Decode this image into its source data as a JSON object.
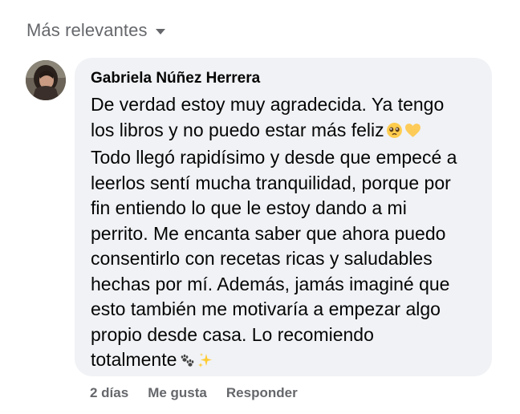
{
  "sort": {
    "label": "Más relevantes"
  },
  "comment": {
    "author": "Gabriela Núñez Herrera",
    "text_lines": [
      "De verdad estoy muy agradecida. Ya tengo",
      "los libros y no puedo estar más feliz",
      "Todo llegó rapidísimo y desde que empecé a",
      "leerlos sentí mucha tranquilidad, porque por",
      "fin entiendo lo que le estoy dando a mi",
      "perrito. Me encanta saber que ahora puedo",
      "consentirlo con recetas ricas y saludables",
      "hechas por mí. Además, jamás imaginé que",
      "esto también me motivaría a empezar algo",
      "propio desde casa. Lo recomiendo",
      "totalmente"
    ],
    "emojis": {
      "line2": [
        "pleading-face-emoji",
        "yellow-heart-emoji"
      ],
      "line11": [
        "paw-prints-emoji",
        "sparkles-emoji"
      ]
    }
  },
  "actions": {
    "time": "2 días",
    "like": "Me gusta",
    "reply": "Responder"
  },
  "colors": {
    "bubble": "#f0f2f5",
    "secondary_text": "#65676b",
    "primary_text": "#050505"
  }
}
